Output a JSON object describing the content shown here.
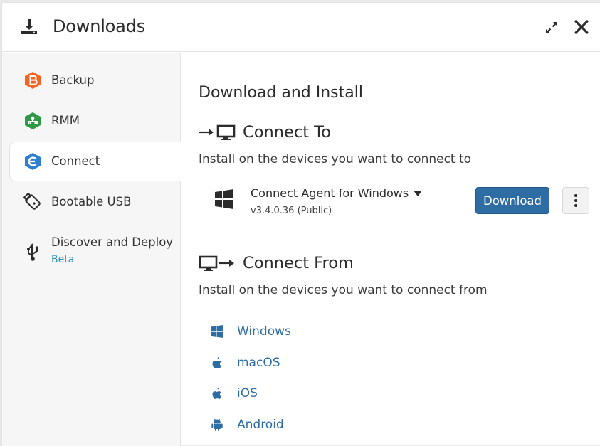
{
  "header": {
    "title": "Downloads",
    "icons": [
      "download-icon",
      "expand-icon",
      "close-icon"
    ]
  },
  "sidebar": {
    "items": [
      {
        "label": "Backup",
        "icon": "backup-icon",
        "color": "#f26522"
      },
      {
        "label": "RMM",
        "icon": "rmm-icon",
        "color": "#2e9a47"
      },
      {
        "label": "Connect",
        "icon": "connect-icon",
        "color": "#2f7fd1",
        "active": true
      },
      {
        "label": "Bootable USB",
        "icon": "usb-stick-icon"
      },
      {
        "label": "Discover and Deploy",
        "sublabel": "Beta",
        "icon": "usb-trident-icon"
      }
    ]
  },
  "main": {
    "heading": "Download and Install",
    "connect_to": {
      "title": "Connect To",
      "description": "Install on the devices you want to connect to",
      "agent": {
        "name": "Connect Agent for Windows",
        "version": "v3.4.0.36 (Public)",
        "download_label": "Download"
      }
    },
    "connect_from": {
      "title": "Connect From",
      "description": "Install on the devices you want to connect from",
      "platforms": [
        {
          "label": "Windows",
          "icon": "windows-icon"
        },
        {
          "label": "macOS",
          "icon": "apple-icon"
        },
        {
          "label": "iOS",
          "icon": "apple-icon"
        },
        {
          "label": "Android",
          "icon": "android-icon"
        }
      ]
    }
  },
  "colors": {
    "accent": "#2e6da4",
    "link": "#2e6da4",
    "beta": "#2a8fb8",
    "sidebar_bg": "#f6f6f6"
  }
}
